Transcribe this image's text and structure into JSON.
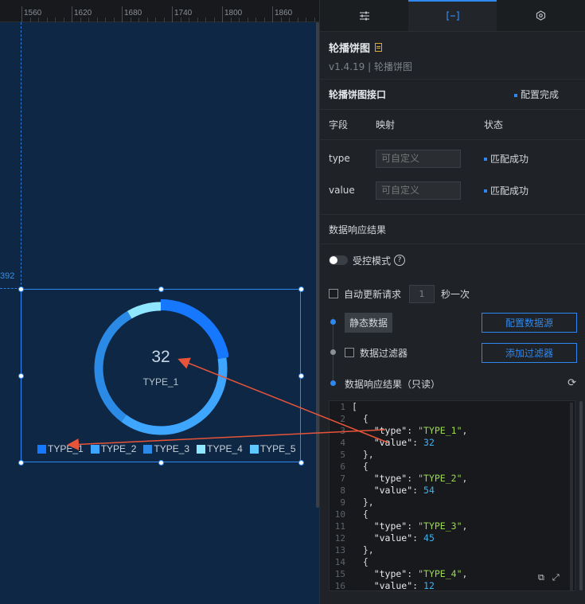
{
  "ruler": {
    "ticks": [
      "1560",
      "1620",
      "1680",
      "1740",
      "1800",
      "1860"
    ]
  },
  "guide": {
    "label": "392"
  },
  "chart": {
    "center_value": "32",
    "center_label": "TYPE_1",
    "legend": [
      "TYPE_1",
      "TYPE_2",
      "TYPE_3",
      "TYPE_4",
      "TYPE_5"
    ],
    "colors": [
      "#1677ff",
      "#3ea6ff",
      "#2a8ae6",
      "#8ee6ff",
      "#5ec7ff"
    ]
  },
  "chart_data": {
    "type": "pie",
    "categories": [
      "TYPE_1",
      "TYPE_2",
      "TYPE_3",
      "TYPE_4"
    ],
    "values": [
      32,
      54,
      45,
      12
    ]
  },
  "panel": {
    "tabs": [
      {
        "icon": "sliders-icon"
      },
      {
        "icon": "bracket-icon"
      },
      {
        "icon": "gear-icon"
      }
    ],
    "component_name": "轮播饼图",
    "component_version": "v1.4.19 | 轮播饼图",
    "interface_title": "轮播饼图接口",
    "interface_status": "配置完成",
    "columns": {
      "field": "字段",
      "map": "映射",
      "status": "状态"
    },
    "fields": [
      {
        "name": "type",
        "placeholder": "可自定义",
        "status": "匹配成功"
      },
      {
        "name": "value",
        "placeholder": "可自定义",
        "status": "匹配成功"
      }
    ],
    "response_title": "数据响应结果",
    "controlled_mode": "受控模式",
    "auto_update": "自动更新请求",
    "auto_interval": "1",
    "auto_unit": "秒一次",
    "static_data": "静态数据",
    "config_source": "配置数据源",
    "data_filter": "数据过滤器",
    "add_filter": "添加过滤器",
    "response_readonly": "数据响应结果（只读）"
  },
  "code_lines": [
    {
      "n": "1",
      "t": "["
    },
    {
      "n": "2",
      "t": "  {"
    },
    {
      "n": "3",
      "k": "    \"type\"",
      "v": "\"TYPE_1\"",
      "vt": "s",
      "tail": ","
    },
    {
      "n": "4",
      "k": "    \"value\"",
      "v": "32",
      "vt": "n",
      "tail": ""
    },
    {
      "n": "5",
      "t": "  },"
    },
    {
      "n": "6",
      "t": "  {"
    },
    {
      "n": "7",
      "k": "    \"type\"",
      "v": "\"TYPE_2\"",
      "vt": "s",
      "tail": ","
    },
    {
      "n": "8",
      "k": "    \"value\"",
      "v": "54",
      "vt": "n",
      "tail": ""
    },
    {
      "n": "9",
      "t": "  },"
    },
    {
      "n": "10",
      "t": "  {"
    },
    {
      "n": "11",
      "k": "    \"type\"",
      "v": "\"TYPE_3\"",
      "vt": "s",
      "tail": ","
    },
    {
      "n": "12",
      "k": "    \"value\"",
      "v": "45",
      "vt": "n",
      "tail": ""
    },
    {
      "n": "13",
      "t": "  },"
    },
    {
      "n": "14",
      "t": "  {"
    },
    {
      "n": "15",
      "k": "    \"type\"",
      "v": "\"TYPE_4\"",
      "vt": "s",
      "tail": ","
    },
    {
      "n": "16",
      "k": "    \"value\"",
      "v": "12",
      "vt": "n",
      "tail": ""
    }
  ]
}
